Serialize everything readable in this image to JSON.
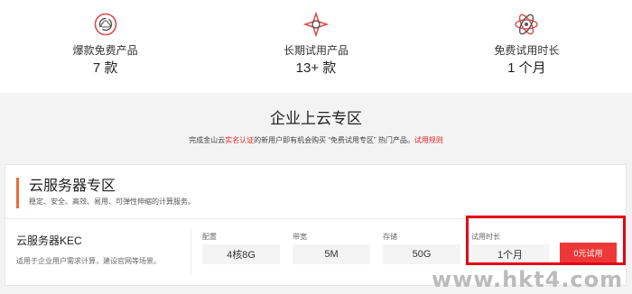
{
  "stats": [
    {
      "label": "爆款免费产品",
      "value": "7 款",
      "icon": "cloud-cycle-icon"
    },
    {
      "label": "长期试用产品",
      "value": "13+ 款",
      "icon": "shuriken-icon"
    },
    {
      "label": "免费试用时长",
      "value": "1 个月",
      "icon": "atom-icon"
    }
  ],
  "zone": {
    "title": "企业上云专区",
    "subtitle_pre": "完成金山云",
    "subtitle_hl": "实名认证",
    "subtitle_mid": "的新用户即有机会购买 “免费试用专区” 热门产品。",
    "subtitle_link": "试用规则"
  },
  "card": {
    "title": "云服务器专区",
    "desc": "稳定、安全、高效、易用、可弹性伸缩的计算服务。"
  },
  "product": {
    "name": "云服务器KEC",
    "desc": "适用于企业用户需求计算，建设官网等场景。",
    "config_label": "配置",
    "config_value": "4核8G",
    "bandwidth_label": "带宽",
    "bandwidth_value": "5M",
    "storage_label": "存储",
    "storage_value": "50G",
    "trial_label": "试用时长",
    "trial_value": "1个月",
    "trial_button": "0元试用"
  },
  "watermark": "www.hkt4.com",
  "colors": {
    "accent": "#ee3837",
    "highlight": "#e60012",
    "bar": "#f06a35"
  }
}
